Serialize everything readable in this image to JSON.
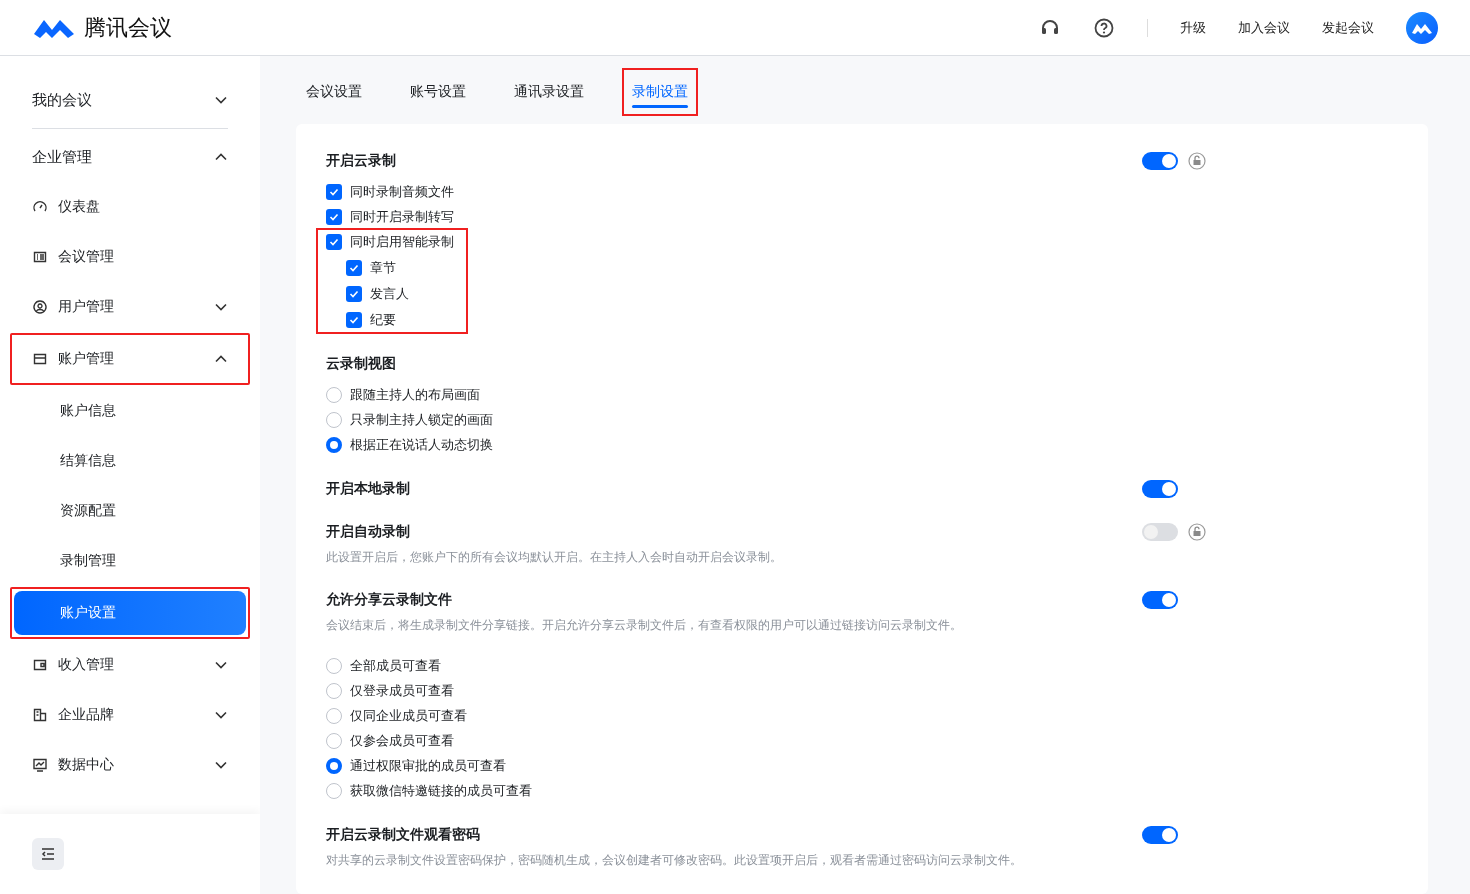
{
  "header": {
    "brand": "腾讯会议",
    "links": [
      "升级",
      "加入会议",
      "发起会议"
    ]
  },
  "sidebar": {
    "items": [
      {
        "label": "我的会议",
        "expanded": false
      },
      {
        "label": "企业管理",
        "expanded": true,
        "children": [
          {
            "kind": "link",
            "label": "仪表盘",
            "highlighted": false,
            "selected": false
          },
          {
            "kind": "link",
            "label": "会议管理",
            "highlighted": false,
            "selected": false
          },
          {
            "kind": "group",
            "label": "用户管理",
            "expanded": false,
            "highlighted": false,
            "selected": false
          },
          {
            "kind": "group",
            "label": "账户管理",
            "expanded": true,
            "highlighted": true,
            "selected": false,
            "children": [
              {
                "label": "账户信息",
                "selected": false,
                "highlighted": false
              },
              {
                "label": "结算信息",
                "selected": false,
                "highlighted": false
              },
              {
                "label": "资源配置",
                "selected": false,
                "highlighted": false
              },
              {
                "label": "录制管理",
                "selected": false,
                "highlighted": false
              },
              {
                "label": "账户设置",
                "selected": true,
                "highlighted": true
              }
            ]
          },
          {
            "kind": "group",
            "label": "收入管理",
            "expanded": false,
            "highlighted": false,
            "selected": false
          },
          {
            "kind": "group",
            "label": "企业品牌",
            "expanded": false,
            "highlighted": false,
            "selected": false
          },
          {
            "kind": "group",
            "label": "数据中心",
            "expanded": false,
            "highlighted": false,
            "selected": false
          }
        ]
      }
    ]
  },
  "tabs": [
    {
      "label": "会议设置",
      "selected": false,
      "highlighted": false
    },
    {
      "label": "账号设置",
      "selected": false,
      "highlighted": false
    },
    {
      "label": "通讯录设置",
      "selected": false,
      "highlighted": false
    },
    {
      "label": "录制设置",
      "selected": true,
      "highlighted": true
    }
  ],
  "settings": [
    {
      "title": "开启云录制",
      "toggle": {
        "on": true,
        "lock": true
      },
      "options": [
        {
          "kind": "checkbox",
          "label": "同时录制音频文件",
          "checked": true,
          "highlighted": false
        },
        {
          "kind": "checkbox",
          "label": "同时开启录制转写",
          "checked": true,
          "highlighted": false
        },
        {
          "kind": "checkbox",
          "label": "同时启用智能录制",
          "checked": true,
          "highlighted": true,
          "children": [
            {
              "label": "章节",
              "checked": true
            },
            {
              "label": "发言人",
              "checked": true
            },
            {
              "label": "纪要",
              "checked": true
            }
          ]
        }
      ]
    },
    {
      "title": "云录制视图",
      "options": [
        {
          "kind": "radio",
          "label": "跟随主持人的布局画面",
          "selected": false
        },
        {
          "kind": "radio",
          "label": "只录制主持人锁定的画面",
          "selected": false
        },
        {
          "kind": "radio",
          "label": "根据正在说话人动态切换",
          "selected": true
        }
      ]
    },
    {
      "title": "开启本地录制",
      "toggle": {
        "on": true,
        "lock": false
      }
    },
    {
      "title": "开启自动录制",
      "toggle": {
        "on": false,
        "lock": true
      },
      "description": "此设置开启后，您账户下的所有会议均默认开启。在主持人入会时自动开启会议录制。"
    },
    {
      "title": "允许分享云录制文件",
      "toggle": {
        "on": true,
        "lock": false
      },
      "description": "会议结束后，将生成录制文件分享链接。开启允许分享云录制文件后，有查看权限的用户可以通过链接访问云录制文件。",
      "options": [
        {
          "kind": "radio",
          "label": "全部成员可查看",
          "selected": false
        },
        {
          "kind": "radio",
          "label": "仅登录成员可查看",
          "selected": false
        },
        {
          "kind": "radio",
          "label": "仅同企业成员可查看",
          "selected": false
        },
        {
          "kind": "radio",
          "label": "仅参会成员可查看",
          "selected": false
        },
        {
          "kind": "radio",
          "label": "通过权限审批的成员可查看",
          "selected": true
        },
        {
          "kind": "radio",
          "label": "获取微信特邀链接的成员可查看",
          "selected": false
        }
      ]
    },
    {
      "title": "开启云录制文件观看密码",
      "toggle": {
        "on": true,
        "lock": false
      },
      "description": "对共享的云录制文件设置密码保护，密码随机生成，会议创建者可修改密码。此设置项开启后，观看者需通过密码访问云录制文件。"
    }
  ]
}
